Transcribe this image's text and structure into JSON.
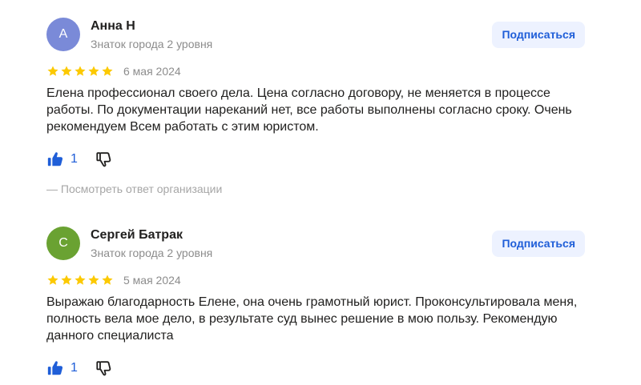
{
  "reviews": [
    {
      "avatar_letter": "А",
      "avatar_color": "#7a8ad8",
      "author_name": "Анна Н",
      "author_level": "Знаток города 2 уровня",
      "subscribe_label": "Подписаться",
      "rating": 5,
      "date": "6 мая 2024",
      "text": "Елена профессионал своего дела. Цена согласно договору, не меняется в процессе работы. По документации нареканий нет, все работы выполнены согласно сроку. Очень рекомендуем Всем работать с этим юристом.",
      "likes": "1",
      "org_answer_label": "— Посмотреть ответ организации"
    },
    {
      "avatar_letter": "С",
      "avatar_color": "#6aa232",
      "author_name": "Сергей Батрак",
      "author_level": "Знаток города 2 уровня",
      "subscribe_label": "Подписаться",
      "rating": 5,
      "date": "5 мая 2024",
      "text": "Выражаю благодарность Елене, она очень грамотный юрист. Проконсультировала меня, полность вела мое дело, в результате суд вынес решение в мою пользу. Рекомендую данного специалиста",
      "likes": "1"
    }
  ],
  "colors": {
    "star": "#fcc900",
    "like": "#1f5ed8",
    "dislike": "#21201f",
    "subscribe_bg": "#edf2ff",
    "subscribe_text": "#1f5ed8"
  }
}
